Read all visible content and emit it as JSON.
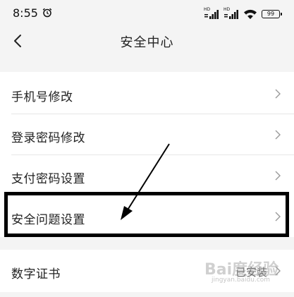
{
  "status_bar": {
    "time": "8:55",
    "battery": "99",
    "signal_label": "HD"
  },
  "nav": {
    "title": "安全中心"
  },
  "menu": {
    "items": [
      {
        "label": "手机号修改"
      },
      {
        "label": "登录密码修改"
      },
      {
        "label": "支付密码设置"
      },
      {
        "label": "安全问题设置"
      }
    ],
    "digital_cert": {
      "label": "数字证书",
      "value": "已安装"
    }
  },
  "watermark": {
    "text": "Bai度经验",
    "sub": "jingyan.baidu.com"
  }
}
